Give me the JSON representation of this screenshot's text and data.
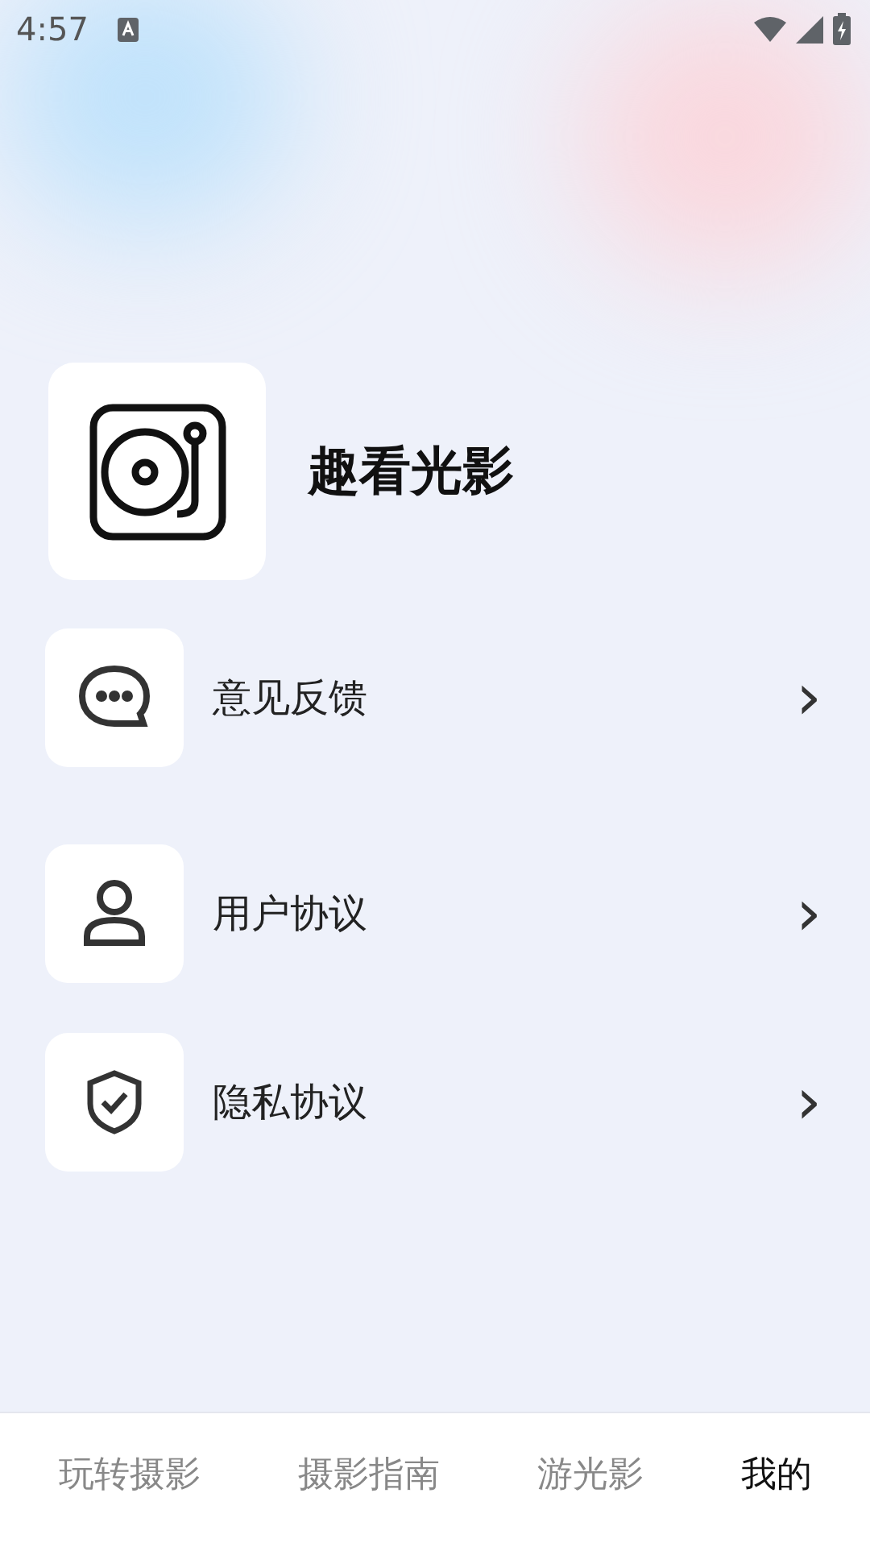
{
  "status_bar": {
    "time": "4:57"
  },
  "app": {
    "name": "趣看光影"
  },
  "menu": [
    {
      "kind": "feedback",
      "label": "意见反馈",
      "chevron": "›"
    },
    {
      "kind": "user",
      "label": "用户协议",
      "chevron": "›"
    },
    {
      "kind": "privacy",
      "label": "隐私协议",
      "chevron": "›"
    }
  ],
  "tabs": [
    {
      "label": "玩转摄影",
      "selected": false
    },
    {
      "label": "摄影指南",
      "selected": false
    },
    {
      "label": "游光影",
      "selected": false
    },
    {
      "label": "我的",
      "selected": true
    }
  ]
}
